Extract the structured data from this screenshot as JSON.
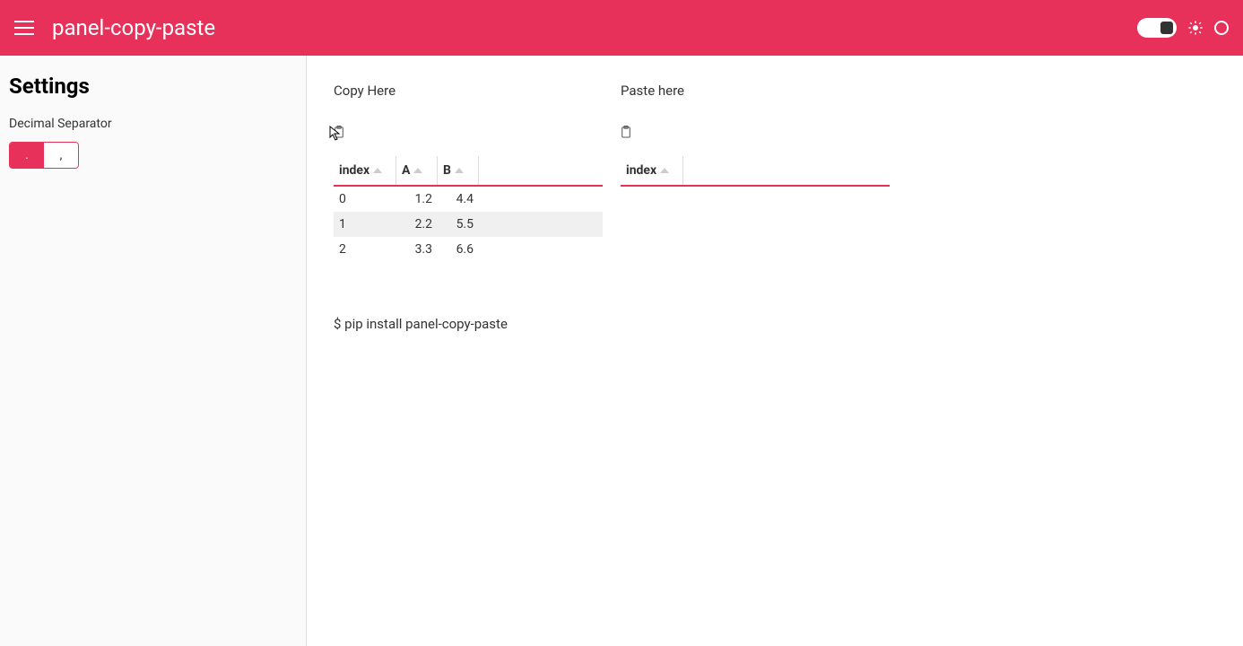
{
  "header": {
    "title": "panel-copy-paste"
  },
  "sidebar": {
    "title": "Settings",
    "decimal_separator_label": "Decimal Separator",
    "options": [
      {
        "label": ".",
        "active": true
      },
      {
        "label": ",",
        "active": false
      }
    ]
  },
  "copy_panel": {
    "title": "Copy Here",
    "columns": [
      "index",
      "A",
      "B"
    ],
    "rows": [
      {
        "index": "0",
        "A": "1.2",
        "B": "4.4",
        "highlight": false
      },
      {
        "index": "1",
        "A": "2.2",
        "B": "5.5",
        "highlight": true
      },
      {
        "index": "2",
        "A": "3.3",
        "B": "6.6",
        "highlight": false
      }
    ]
  },
  "paste_panel": {
    "title": "Paste here",
    "columns": [
      "index"
    ],
    "rows": []
  },
  "install_cmd": "$ pip install panel-copy-paste"
}
